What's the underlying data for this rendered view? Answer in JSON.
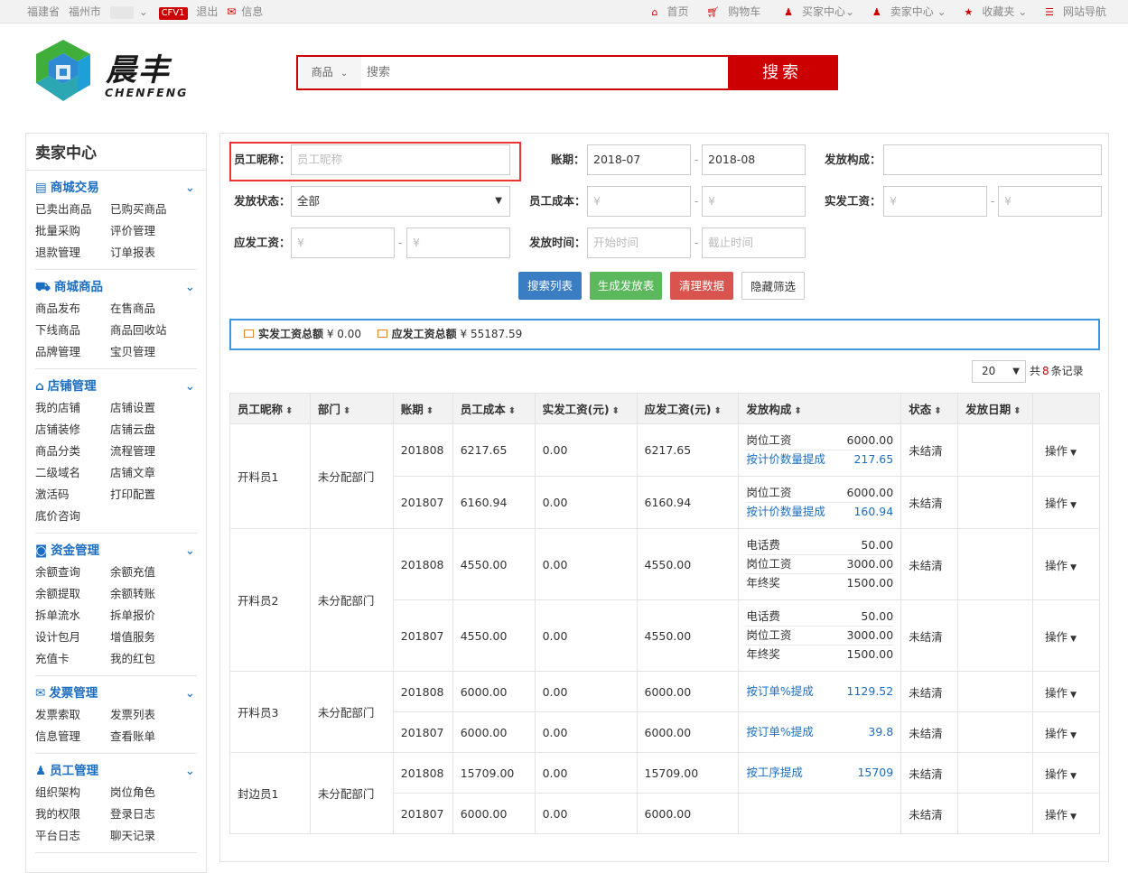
{
  "topbar": {
    "province": "福建省",
    "city": "福州市",
    "cfv": "CFV1",
    "logout": "退出",
    "msg": "信息",
    "home": "首页",
    "cart": "购物车",
    "buyer": "买家中心",
    "seller": "卖家中心",
    "fav": "收藏夹",
    "nav": "网站导航"
  },
  "logo": {
    "cn": "晨丰",
    "en": "CHENFENG"
  },
  "search": {
    "category": "商品",
    "placeholder": "搜索",
    "button": "搜索"
  },
  "sidebar": {
    "title": "卖家中心",
    "sections": [
      {
        "title": "商城交易",
        "icon": "card-icon",
        "glyph": "▤",
        "links": [
          "已卖出商品",
          "已购买商品",
          "批量采购",
          "评价管理",
          "退款管理",
          "订单报表"
        ]
      },
      {
        "title": "商城商品",
        "icon": "truck-icon",
        "glyph": "⛟",
        "links": [
          "商品发布",
          "在售商品",
          "下线商品",
          "商品回收站",
          "品牌管理",
          "宝贝管理"
        ]
      },
      {
        "title": "店铺管理",
        "icon": "home-icon",
        "glyph": "⌂",
        "links": [
          "我的店铺",
          "店铺设置",
          "店铺装修",
          "店铺云盘",
          "商品分类",
          "流程管理",
          "二级域名",
          "店铺文章",
          "激活码",
          "打印配置",
          "底价咨询"
        ]
      },
      {
        "title": "资金管理",
        "icon": "money-icon",
        "glyph": "◙",
        "links": [
          "余额查询",
          "余额充值",
          "余额提取",
          "余额转账",
          "拆单流水",
          "拆单报价",
          "设计包月",
          "增值服务",
          "充值卡",
          "我的红包"
        ]
      },
      {
        "title": "发票管理",
        "icon": "envelope-icon",
        "glyph": "✉",
        "links": [
          "发票索取",
          "发票列表",
          "信息管理",
          "查看账单"
        ]
      },
      {
        "title": "员工管理",
        "icon": "users-icon",
        "glyph": "♟",
        "links": [
          "组织架构",
          "岗位角色",
          "我的权限",
          "登录日志",
          "平台日志",
          "聊天记录"
        ]
      }
    ]
  },
  "filters": {
    "nickname_label": "员工昵称：",
    "nickname_ph": "员工昵称",
    "period_label": "账期：",
    "period_from": "2018-07",
    "period_to": "2018-08",
    "composition_label": "发放构成：",
    "status_label": "发放状态：",
    "status_value": "全部",
    "cost_label": "员工成本：",
    "actual_label": "实发工资：",
    "due_label": "应发工资：",
    "money_ph": "¥",
    "time_label": "发放时间：",
    "time_start_ph": "开始时间",
    "time_end_ph": "截止时间",
    "dash": "-"
  },
  "buttons": {
    "search_list": "搜索列表",
    "generate": "生成发放表",
    "clear": "清理数据",
    "hide": "隐藏筛选"
  },
  "summary": {
    "actual_label": "实发工资总额",
    "actual_value": "¥ 0.00",
    "due_label": "应发工资总额",
    "due_value": "¥ 55187.59"
  },
  "pager": {
    "size": "20",
    "prefix": "共",
    "count": "8",
    "suffix": "条记录"
  },
  "table": {
    "headers": [
      "员工昵称",
      "部门",
      "账期",
      "员工成本",
      "实发工资(元)",
      "应发工资(元)",
      "发放构成",
      "状态",
      "发放日期",
      ""
    ],
    "op_label": "操作",
    "groups": [
      {
        "name": "开料员1",
        "dept": "未分配部门",
        "rows": [
          {
            "period": "201808",
            "cost": "6217.65",
            "actual": "0.00",
            "due": "6217.65",
            "status": "未结清",
            "comp": [
              {
                "k": "岗位工资",
                "v": "6000.00",
                "blue": false
              },
              {
                "k": "按计价数量提成",
                "v": "217.65",
                "blue": true
              }
            ]
          },
          {
            "period": "201807",
            "cost": "6160.94",
            "actual": "0.00",
            "due": "6160.94",
            "status": "未结清",
            "comp": [
              {
                "k": "岗位工资",
                "v": "6000.00",
                "blue": false
              },
              {
                "k": "按计价数量提成",
                "v": "160.94",
                "blue": true
              }
            ]
          }
        ]
      },
      {
        "name": "开料员2",
        "dept": "未分配部门",
        "rows": [
          {
            "period": "201808",
            "cost": "4550.00",
            "actual": "0.00",
            "due": "4550.00",
            "status": "未结清",
            "comp": [
              {
                "k": "电话费",
                "v": "50.00",
                "blue": false
              },
              {
                "k": "岗位工资",
                "v": "3000.00",
                "blue": false
              },
              {
                "k": "年终奖",
                "v": "1500.00",
                "blue": false
              }
            ]
          },
          {
            "period": "201807",
            "cost": "4550.00",
            "actual": "0.00",
            "due": "4550.00",
            "status": "未结清",
            "comp": [
              {
                "k": "电话费",
                "v": "50.00",
                "blue": false
              },
              {
                "k": "岗位工资",
                "v": "3000.00",
                "blue": false
              },
              {
                "k": "年终奖",
                "v": "1500.00",
                "blue": false
              }
            ]
          }
        ]
      },
      {
        "name": "开料员3",
        "dept": "未分配部门",
        "rows": [
          {
            "period": "201808",
            "cost": "6000.00",
            "actual": "0.00",
            "due": "6000.00",
            "status": "未结清",
            "comp": [
              {
                "k": "按订单%提成",
                "v": "1129.52",
                "blue": true
              }
            ]
          },
          {
            "period": "201807",
            "cost": "6000.00",
            "actual": "0.00",
            "due": "6000.00",
            "status": "未结清",
            "comp": [
              {
                "k": "按订单%提成",
                "v": "39.8",
                "blue": true
              }
            ]
          }
        ]
      },
      {
        "name": "封边员1",
        "dept": "未分配部门",
        "rows": [
          {
            "period": "201808",
            "cost": "15709.00",
            "actual": "0.00",
            "due": "15709.00",
            "status": "未结清",
            "comp": [
              {
                "k": "按工序提成",
                "v": "15709",
                "blue": true
              }
            ]
          },
          {
            "period": "201807",
            "cost": "6000.00",
            "actual": "0.00",
            "due": "6000.00",
            "status": "未结清",
            "comp": []
          }
        ]
      }
    ]
  },
  "colors": {
    "brand_red": "#cc0000",
    "link_blue": "#1b6ec2",
    "btn_blue": "#3a7dc2",
    "btn_green": "#5cb85c",
    "btn_red": "#d9534f"
  }
}
